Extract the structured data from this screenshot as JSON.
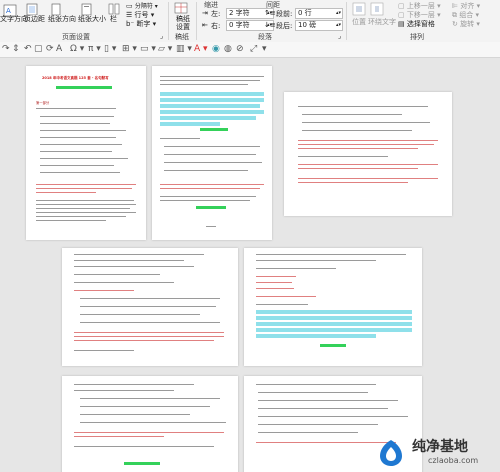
{
  "ribbon": {
    "text_direction": "文字方向",
    "margins": "页边距",
    "orientation": "纸张方向",
    "size": "纸张大小",
    "columns": "栏",
    "line_numbers": "行号",
    "hyphenation": "断字",
    "page_setup_group": "页面设置",
    "draft": "稿纸",
    "draft_settings": "设置",
    "draft_group": "稿纸",
    "indent_label": "缩进",
    "spacing_label": "间距",
    "indent_left_label": "左:",
    "indent_left_value": "2 字符",
    "indent_right_label": "右:",
    "indent_right_value": "0 字符",
    "space_before_label": "段前:",
    "space_before_value": "0 行",
    "space_after_label": "段后:",
    "space_after_value": "10 磅",
    "paragraph_group": "段落",
    "position": "位置",
    "wrap_text": "环绕文字",
    "bring_forward": "上移一层",
    "send_backward": "下移一层",
    "selection_pane": "选择窗格",
    "align": "对齐",
    "group": "组合",
    "rotate": "旋转",
    "arrange_group": "排列"
  },
  "document": {
    "page1_title": "2018 年中考语文真题 125 套 - 名句默写",
    "page1_subtitle": "",
    "page1_section": "第一部分"
  },
  "watermark": {
    "brand": "纯净基地",
    "url": "czlaoba.com"
  },
  "colors": {
    "highlight_cyan": "#8fe0ea",
    "highlight_green": "#34d15a",
    "text_red": "#d02020"
  }
}
